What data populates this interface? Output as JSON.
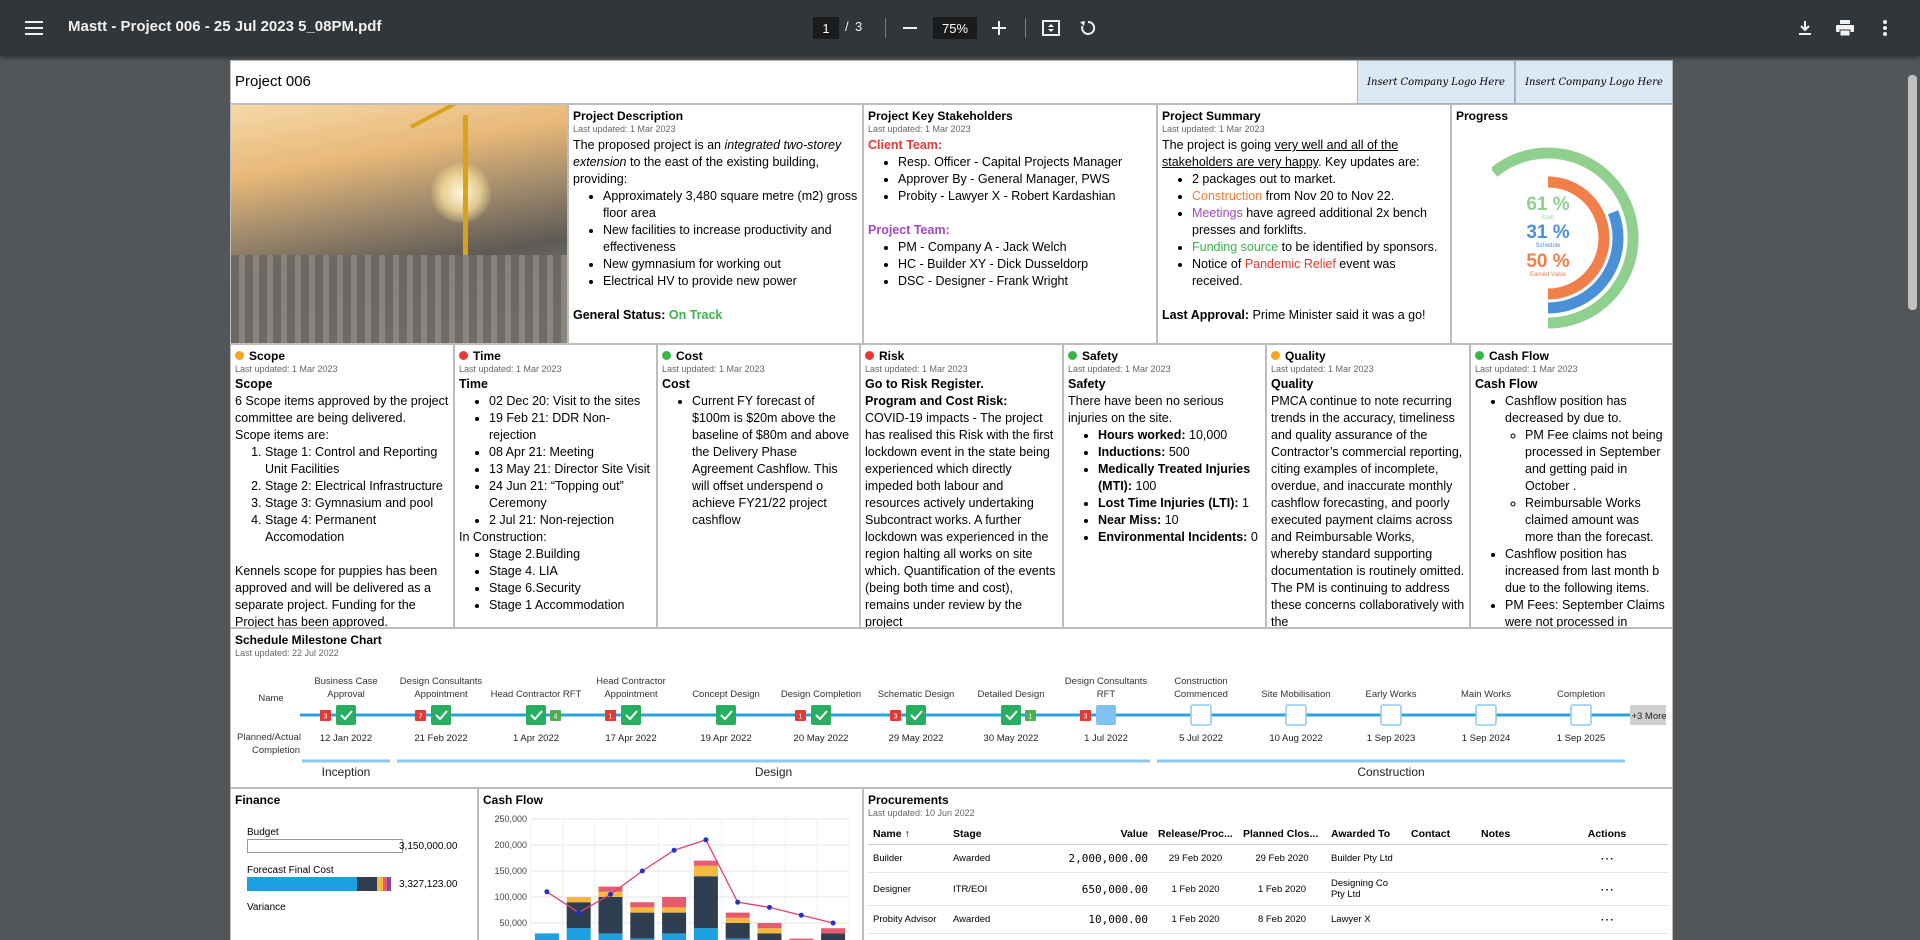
{
  "toolbar": {
    "title": "Mastt - Project 006 - 25 Jul 2023 5_08PM.pdf",
    "page_current": "1",
    "page_sep": "/",
    "page_total": "3",
    "zoom": "75%"
  },
  "project": {
    "title": "Project 006",
    "logo1": "Insert Company Logo Here",
    "logo2": "Insert Company Logo Here"
  },
  "description": {
    "heading": "Project Description",
    "updated": "Last updated: 1 Mar 2023",
    "p1": "The proposed project is an ",
    "p1_italic": "integrated two-storey extension",
    "p1_end": " to the east of the existing building, providing:",
    "items": [
      "Approximately 3,480 square metre (m2) gross floor area",
      "New facilities to increase productivity and effectiveness",
      "New gymnasium for working out",
      "Electrical HV to provide new power"
    ],
    "status_label": "General Status:",
    "status_value": "On Track"
  },
  "stakeholders": {
    "heading": "Project Key Stakeholders",
    "updated": "Last updated: 1 Mar 2023",
    "client_label": "Client Team:",
    "client": [
      "Resp. Officer - Capital Projects Manager",
      "Approver By - General Manager, PWS",
      "Probity - Lawyer X - Robert Kardashian"
    ],
    "project_label": "Project Team:",
    "project": [
      "PM - Company A - Jack Welch",
      "HC - Builder XY - Dick Dusseldorp",
      "DSC - Designer - Frank Wright"
    ]
  },
  "summary": {
    "heading": "Project Summary",
    "updated": "Last updated: 1 Mar 2023",
    "intro1": "The project is going ",
    "intro_underline": "very well and all of the stakeholders are very happy",
    "intro2": ". Key updates are:",
    "b1": "2 packages out to market.",
    "b2_hl": "Construction",
    "b2": " from Nov 20 to Nov 22.",
    "b3_hl": "Meetings",
    "b3": " have agreed additional 2x bench presses and forklifts.",
    "b4_hl": "Funding source",
    "b4": " to be identified by sponsors.",
    "b5a": "Notice of ",
    "b5_hl": "Pandemic Relief",
    "b5b": " event was received.",
    "approval_label": "Last Approval:",
    "approval": " Prime Minister said it was a go!"
  },
  "progress": {
    "heading": "Progress",
    "cost_pct": "61 %",
    "cost_label": "Cost",
    "cost_value": 61,
    "schedule_pct": "31 %",
    "schedule_label": "Schedule",
    "schedule_value": 31,
    "ev_pct": "50 %",
    "ev_label": "Earned Value",
    "ev_value": 50,
    "colors": {
      "cost": "#8fd08f",
      "schedule": "#4a90d9",
      "ev": "#f07f4a"
    }
  },
  "scope": {
    "heading": "Scope",
    "updated": "Last updated: 1 Mar 2023",
    "title": "Scope",
    "p1": "6 Scope items approved by the project committee are being delivered.",
    "p2": "Scope items are:",
    "items": [
      "Stage 1: Control and Reporting Unit Facilities",
      "Stage 2: Electrical Infrastructure",
      "Stage 3: Gymnasium and pool",
      "Stage 4: Permanent Accomodation"
    ],
    "p3": "Kennels scope for puppies has been approved and will be delivered as a separate project. Funding for the Project has been approved."
  },
  "time": {
    "heading": "Time",
    "updated": "Last updated: 1 Mar 2023",
    "title": "Time",
    "items": [
      "02 Dec 20: Visit to the sites",
      "19 Feb 21: DDR Non-rejection",
      "08 Apr 21: Meeting",
      "13 May 21: Director Site Visit",
      "24 Jun 21: “Topping out” Ceremony",
      "2 Jul 21:  Non-rejection"
    ],
    "sub": "In Construction:",
    "items2": [
      "Stage 2.Building",
      "Stage 4. LIA",
      "Stage 6.Security",
      "Stage 1 Accommodation"
    ]
  },
  "cost": {
    "heading": "Cost",
    "updated": "Last updated: 1 Mar 2023",
    "title": "Cost",
    "items": [
      "Current FY forecast of $100m is $20m above the baseline of $80m and above the Delivery Phase Agreement Cashflow. This will offset underspend o achieve FY21/22 project cashflow"
    ]
  },
  "risk": {
    "heading": "Risk",
    "updated": "Last updated: 1 Mar 2023",
    "title1": "Go to Risk Register.",
    "title2": "Program and Cost Risk:",
    "p": "COVID-19 impacts - The project has realised this Risk with the first lockdown event in the state being experienced  which directly impeded both labour and resources actively undertaking Subcontract works. A further lockdown was experienced in the region halting all works on site which. Quantification of the events (being both time and cost), remains under review by the project"
  },
  "safety": {
    "heading": "Safety",
    "updated": "Last updated: 1 Mar 2023",
    "title": "Safety",
    "p": "There have been no serious injuries on the site.",
    "items": [
      {
        "label": "Hours worked:",
        "value": " 10,000"
      },
      {
        "label": "Inductions:",
        "value": " 500"
      },
      {
        "label": "Medically Treated Injuries (MTI):",
        "value": " 100"
      },
      {
        "label": "Lost Time Injuries (LTI):",
        "value": " 1"
      },
      {
        "label": "Near Miss:",
        "value": " 10"
      },
      {
        "label": "Environmental Incidents:",
        "value": " 0"
      }
    ]
  },
  "quality": {
    "heading": "Quality",
    "updated": "Last updated: 1 Mar 2023",
    "title": "Quality",
    "p": "PMCA continue to note recurring trends in the accuracy, timeliness and quality assurance of the Contractor’s commercial reporting, citing examples of incomplete, overdue, and inaccurate monthly cashflow forecasting, and poorly executed payment claims across and Reimbursable Works, whereby standard supporting documentation is routinely omitted. The PM is continuing to address these concerns collaboratively with the"
  },
  "cashflow_box": {
    "heading": "Cash Flow",
    "updated": "Last updated: 1 Mar 2023",
    "title": "Cash Flow",
    "b1": "Cashflow position has decreased by due to.",
    "sub1": "PM Fee claims not being processed in September and getting paid in October .",
    "sub2": "Reimbursable Works claimed amount was more than the forecast.",
    "b2": "Cashflow position has increased from last month b due to the following items.",
    "b3": "PM Fees: September Claims were not processed in"
  },
  "schedule": {
    "heading": "Schedule Milestone Chart",
    "updated": "Last updated: 22 Jul 2022",
    "name_label": "Name",
    "planned_label1": "Planned/Actual",
    "planned_label2": "Completion",
    "more": "+3 More",
    "milestones": [
      {
        "name1": "Business Case",
        "name2": "Approval",
        "date": "12 Jan 2022",
        "status": "done",
        "late": "3"
      },
      {
        "name1": "Design Consultants",
        "name2": "Appointment",
        "date": "21 Feb 2022",
        "status": "done",
        "late": "7"
      },
      {
        "name1": "",
        "name2": "Head Contractor RFT",
        "date": "1 Apr 2022",
        "status": "done",
        "early": "4"
      },
      {
        "name1": "Head Contractor",
        "name2": "Appointment",
        "date": "17 Apr 2022",
        "status": "done",
        "late": "1"
      },
      {
        "name1": "",
        "name2": "Concept Design",
        "date": "19 Apr 2022",
        "status": "done"
      },
      {
        "name1": "",
        "name2": "Design Completion",
        "date": "20 May 2022",
        "status": "done",
        "late": "1"
      },
      {
        "name1": "",
        "name2": "Schematic Design",
        "date": "29 May 2022",
        "status": "done",
        "late": "3"
      },
      {
        "name1": "",
        "name2": "Detailed Design",
        "date": "30 May 2022",
        "status": "done",
        "early": "1"
      },
      {
        "name1": "Design Consultants",
        "name2": "RFT",
        "date": "1 Jul 2022",
        "status": "progress",
        "late": "3"
      },
      {
        "name1": "Construction",
        "name2": "Commenced",
        "date": "5 Jul 2022",
        "status": "pending"
      },
      {
        "name1": "",
        "name2": "Site Mobilisation",
        "date": "10 Aug 2022",
        "status": "pending"
      },
      {
        "name1": "",
        "name2": "Early Works",
        "date": "1 Sep 2023",
        "status": "pending"
      },
      {
        "name1": "",
        "name2": "Main Works",
        "date": "1 Sep 2024",
        "status": "pending"
      },
      {
        "name1": "",
        "name2": "Completion",
        "date": "1 Sep 2025",
        "status": "pending"
      }
    ],
    "phases": [
      {
        "label": "Inception",
        "from": 0,
        "to": 1
      },
      {
        "label": "Design",
        "from": 1,
        "to": 9
      },
      {
        "label": "Construction",
        "from": 9,
        "to": 14
      }
    ]
  },
  "finance": {
    "heading": "Finance",
    "budget_label": "Budget",
    "budget_value": "3,150,000.00",
    "forecast_label": "Forecast Final Cost",
    "forecast_value": "3,327,123.00",
    "variance_label": "Variance"
  },
  "cashflow_chart": {
    "heading": "Cash Flow",
    "chart_data": {
      "type": "bar",
      "yticks": [
        "250,000",
        "200,000",
        "150,000",
        "100,000",
        "50,000"
      ],
      "ylim": [
        0,
        250000
      ],
      "stacks": [
        [
          30000,
          0,
          0,
          0
        ],
        [
          40000,
          50000,
          10000,
          0
        ],
        [
          30000,
          70000,
          10000,
          10000
        ],
        [
          20000,
          50000,
          10000,
          10000
        ],
        [
          30000,
          40000,
          10000,
          20000
        ],
        [
          40000,
          100000,
          20000,
          10000
        ],
        [
          20000,
          30000,
          10000,
          10000
        ],
        [
          10000,
          20000,
          10000,
          10000
        ],
        [
          0,
          0,
          0,
          20000
        ],
        [
          0,
          30000,
          0,
          10000
        ]
      ],
      "stack_colors": [
        "#1ba1e2",
        "#2c3e50",
        "#f5b93e",
        "#e75b6f"
      ],
      "line": [
        110000,
        70000,
        105000,
        150000,
        190000,
        210000,
        90000,
        80000,
        65000,
        50000
      ]
    }
  },
  "procurements": {
    "heading": "Procurements",
    "updated": "Last updated: 10 Jun 2022",
    "columns": [
      "Name",
      "Stage",
      "Value",
      "Release/Proc...",
      "Planned Clos...",
      "Awarded To",
      "Contact",
      "Notes",
      "Actions"
    ],
    "sort_icon": "↑",
    "rows": [
      {
        "name": "Builder",
        "stage": "Awarded",
        "value": "2,000,000.00",
        "release": "29 Feb 2020",
        "close": "29 Feb 2020",
        "awarded": "Builder Pty Ltd"
      },
      {
        "name": "Designer",
        "stage": "ITR/EOI",
        "value": "650,000.00",
        "release": "1 Feb 2020",
        "close": "1 Feb 2020",
        "awarded": "Designing Co Pty Ltd"
      },
      {
        "name": "Probity Advisor",
        "stage": "Awarded",
        "value": "10,000.00",
        "release": "1 Feb 2020",
        "close": "8 Feb 2020",
        "awarded": "Lawyer X"
      }
    ],
    "actions_glyph": "⋯"
  }
}
